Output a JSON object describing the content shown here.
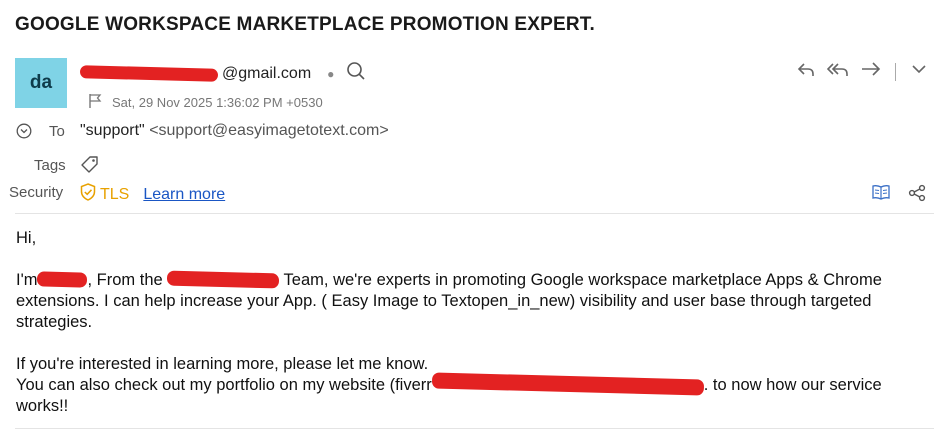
{
  "subject": "GOOGLE WORKSPACE MARKETPLACE PROMOTION EXPERT.",
  "sender": {
    "avatar_initials": "da",
    "email_visible": "@gmail.com",
    "date": "Sat, 29 Nov 2025 1:36:02 PM +0530"
  },
  "recipient": {
    "label": "To",
    "name": "\"support\"",
    "address": "<support@easyimagetotext.com>"
  },
  "tags": {
    "label": "Tags"
  },
  "security": {
    "label": "Security",
    "tls": "TLS",
    "learn_more": "Learn more"
  },
  "body": {
    "greeting": "Hi,",
    "p1_start": "I'm",
    "p1_mid": ", From the",
    "p1_rest": " Team, we're experts in promoting Google workspace marketplace Apps & Chrome extensions. I can help increase your App. ( Easy Image to Textopen_in_new) visibility and user base through targeted strategies.",
    "p2_line1": "If you're interested in learning more, please let me know.",
    "p2_line2_start": "You can also check out my portfolio on my website (fiverr",
    "p2_line2_end": ". to now how our service works!!"
  },
  "colors": {
    "avatar_bg": "#7fd3e6",
    "tls": "#e8a100",
    "link": "#1a56c4",
    "redaction": "#e32222"
  },
  "icons": [
    "search-icon",
    "flag-icon",
    "reply-icon",
    "reply-all-icon",
    "forward-icon",
    "chevron-down-icon",
    "expand-circle-icon",
    "tag-icon",
    "shield-check-icon",
    "reader-icon",
    "share-icon"
  ]
}
